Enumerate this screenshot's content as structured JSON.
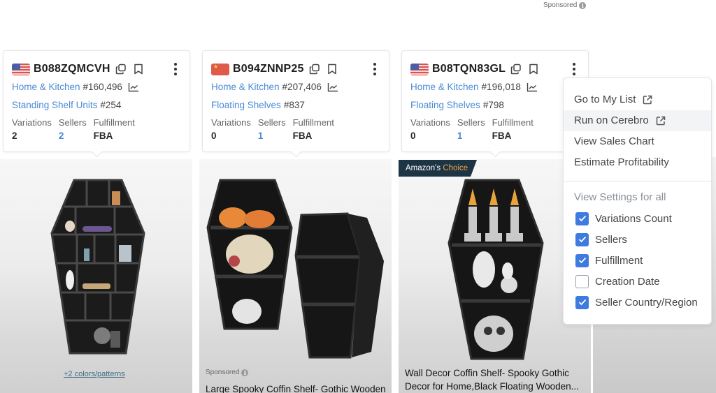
{
  "page": {
    "sponsored_label": "Sponsored",
    "info_icon": "info-icon"
  },
  "products": [
    {
      "flag": "us-flag",
      "asin": "B088ZQMCVH",
      "category": "Home & Kitchen",
      "category_rank": "#160,496",
      "subcategory": "Standing Shelf Units",
      "subcategory_rank": "#254",
      "stats": [
        {
          "label": "Variations",
          "value": "2"
        },
        {
          "label": "Sellers",
          "value": "2"
        },
        {
          "label": "Fulfillment",
          "value": "FBA"
        }
      ],
      "extra_link": "+2 colors/patterns"
    },
    {
      "flag": "cn-flag",
      "asin": "B094ZNNP25",
      "category": "Home & Kitchen",
      "category_rank": "#207,406",
      "subcategory": "Floating Shelves",
      "subcategory_rank": "#837",
      "stats": [
        {
          "label": "Variations",
          "value": "0"
        },
        {
          "label": "Sellers",
          "value": "1"
        },
        {
          "label": "Fulfillment",
          "value": "FBA"
        }
      ],
      "sponsored_label": "Sponsored",
      "title": "Large Spooky Coffin Shelf- Gothic Wooden"
    },
    {
      "flag": "us-flag",
      "asin": "B08TQN83GL",
      "category": "Home & Kitchen",
      "category_rank": "#196,018",
      "subcategory": "Floating Shelves",
      "subcategory_rank": "#798",
      "stats": [
        {
          "label": "Variations",
          "value": "0"
        },
        {
          "label": "Sellers",
          "value": "1"
        },
        {
          "label": "Fulfillment",
          "value": "FBA"
        }
      ],
      "badge": {
        "prefix": "Amazon's",
        "highlight": "Choice"
      },
      "title_line1": "Wall Decor Coffin Shelf- Spooky Gothic",
      "title_line2": "Decor for Home,Black Floating Wooden..."
    }
  ],
  "menu": {
    "actions": [
      {
        "label": "Go to My List",
        "external": true
      },
      {
        "label": "Run on Cerebro",
        "external": true
      },
      {
        "label": "View Sales Chart",
        "external": false
      },
      {
        "label": "Estimate Profitability",
        "external": false
      }
    ],
    "section_title": "View Settings for all",
    "settings": [
      {
        "label": "Variations Count",
        "checked": true
      },
      {
        "label": "Sellers",
        "checked": true
      },
      {
        "label": "Fulfillment",
        "checked": true
      },
      {
        "label": "Creation Date",
        "checked": false
      },
      {
        "label": "Seller Country/Region",
        "checked": true
      }
    ],
    "colors": {
      "accent": "#3d7be0",
      "link": "#4a8ad4"
    }
  }
}
